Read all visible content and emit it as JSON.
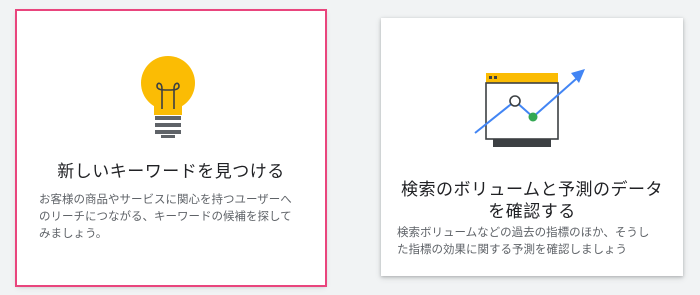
{
  "cards": [
    {
      "title": "新しいキーワードを見つける",
      "description_lines": [
        "お客様の商品やサービスに関心を持つユーザーへ",
        "のリーチにつながる、キーワードの候補を探して",
        "みましょう。"
      ],
      "icon": "lightbulb-icon",
      "selected": true
    },
    {
      "title_lines": [
        "検索のボリュームと予測のデータ",
        "を確認する"
      ],
      "description_lines": [
        "検索ボリュームなどの過去の指標のほか、そうし",
        "た指標の効果に関する予測を確認しましょう"
      ],
      "icon": "forecast-chart-icon",
      "selected": false
    }
  ],
  "colors": {
    "selected_outline": "#e9457d",
    "bulb_yellow": "#fbbc04",
    "chart_blue": "#4285f4",
    "chart_green": "#34a853"
  }
}
